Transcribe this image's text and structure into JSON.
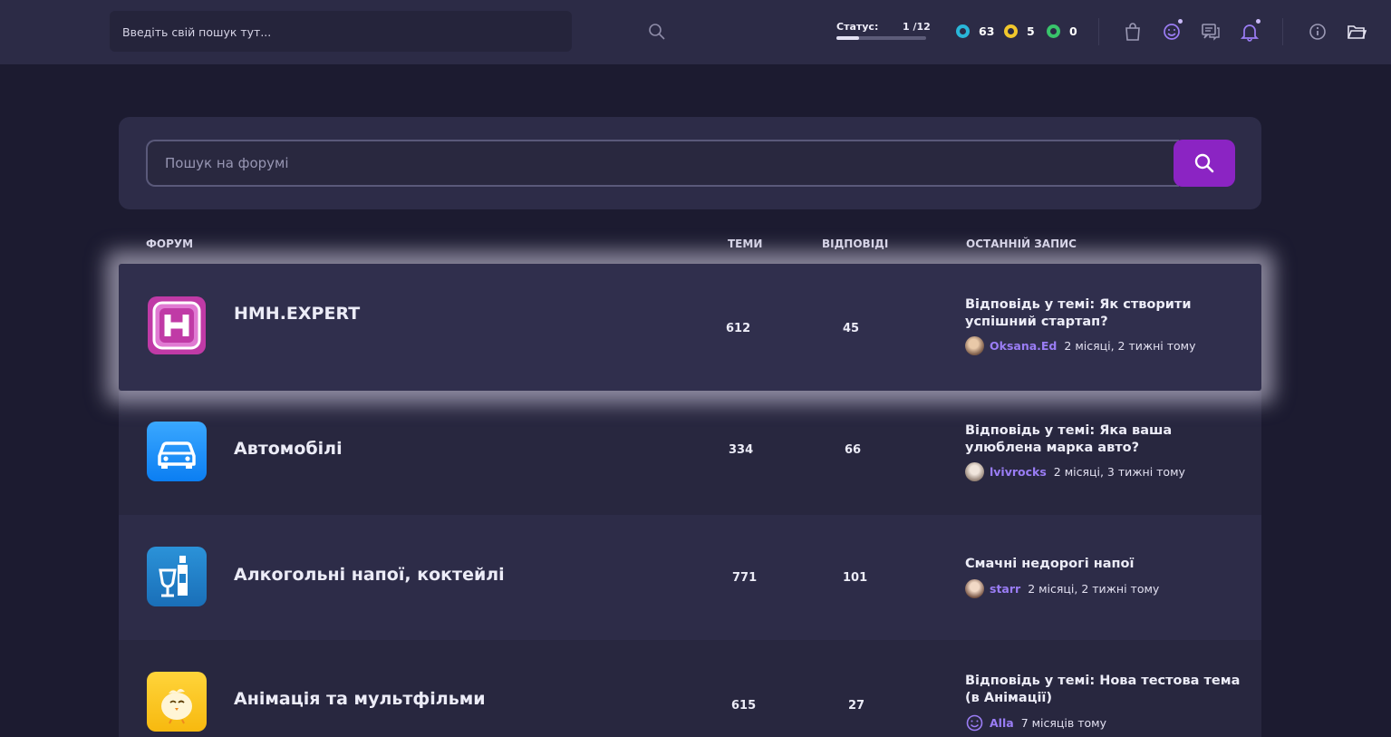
{
  "topbar": {
    "search_placeholder": "Введіть свій пошук тут...",
    "status_label": "Статус:",
    "status_count": "1 /12",
    "status_progress": 0.25,
    "points": [
      {
        "icon": "blue-points-icon",
        "value": "63",
        "color": "#29b6d8"
      },
      {
        "icon": "yellow-points-icon",
        "value": "5",
        "color": "#f1c72c"
      },
      {
        "icon": "green-points-icon",
        "value": "0",
        "color": "#39c46b"
      }
    ],
    "icons": [
      "shop-bag-icon",
      "smile-icon",
      "messages-icon",
      "notifications-bell-icon",
      "info-icon",
      "folder-icon"
    ]
  },
  "forum_search": {
    "placeholder": "Пошук на форумі",
    "button_icon": "search-icon",
    "accent": "#8b24c3"
  },
  "columns": {
    "forum": "ФОРУМ",
    "topics": "ТЕМИ",
    "replies": "ВІДПОВІДІ",
    "last_post": "ОСТАННІЙ ЗАПИС"
  },
  "forums": [
    {
      "icon": "hmh-logo-icon",
      "title": "HMH.EXPERT",
      "topics": "612",
      "replies": "45",
      "last_post_title": "Відповідь у темі: Як створити успішний стартап?",
      "last_post_user": "Oksana.Ed",
      "last_post_time": "2 місяці, 2 тижні тому"
    },
    {
      "icon": "car-icon",
      "title": "Автомобілі",
      "topics": "334",
      "replies": "66",
      "last_post_title": "Відповідь у темі: Яка ваша улюблена марка авто?",
      "last_post_user": "lvivrocks",
      "last_post_time": "2 місяці, 3 тижні тому"
    },
    {
      "icon": "bottle-glass-icon",
      "title": "Алкогольні напої, коктейлі",
      "topics": "771",
      "replies": "101",
      "last_post_title": "Смачні недорогі напої",
      "last_post_user": "starr",
      "last_post_time": "2 місяці, 2 тижні тому"
    },
    {
      "icon": "cartoon-chick-icon",
      "title": "Анімація та мультфільми",
      "topics": "615",
      "replies": "27",
      "last_post_title": "Відповідь у темі: Нова тестова тема (в Анімації)",
      "last_post_user": "Alla",
      "last_post_time": "7 місяців тому"
    }
  ]
}
